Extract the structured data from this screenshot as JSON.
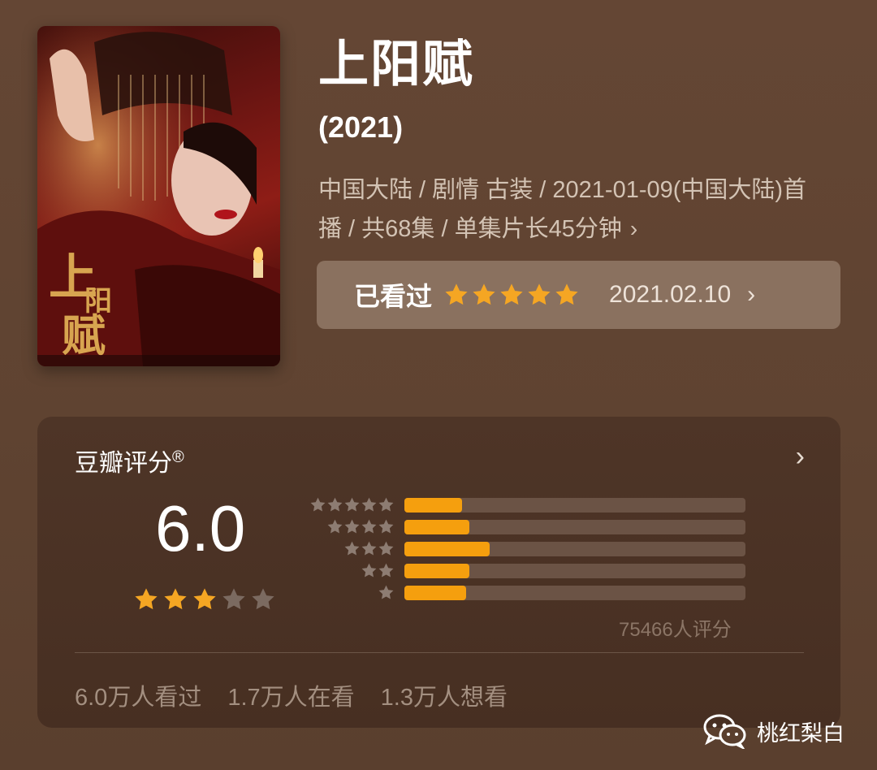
{
  "title": "上阳赋",
  "year": "(2021)",
  "meta": "中国大陆 / 剧情 古装 / 2021-01-09(中国大陆)首播 / 共68集 / 单集片长45分钟",
  "poster": {
    "title_text": "上阳赋"
  },
  "watched": {
    "label": "已看过",
    "stars": 5,
    "date": "2021.02.10"
  },
  "rating": {
    "heading": "豆瓣评分",
    "registered": "®",
    "score": "6.0",
    "stars_filled": 3,
    "stars_total": 5,
    "distribution": [
      {
        "stars": 5,
        "fraction": 0.17
      },
      {
        "stars": 4,
        "fraction": 0.19
      },
      {
        "stars": 3,
        "fraction": 0.25
      },
      {
        "stars": 2,
        "fraction": 0.19
      },
      {
        "stars": 1,
        "fraction": 0.18
      }
    ],
    "raters": "75466人评分"
  },
  "counts": {
    "watched": "6.0万人看过",
    "watching": "1.7万人在看",
    "want": "1.3万人想看"
  },
  "watermark": "桃红梨白",
  "colors": {
    "star_gold": "#f5a623",
    "star_gray": "#7b6a60",
    "bar_fill": "#f59f0e"
  }
}
